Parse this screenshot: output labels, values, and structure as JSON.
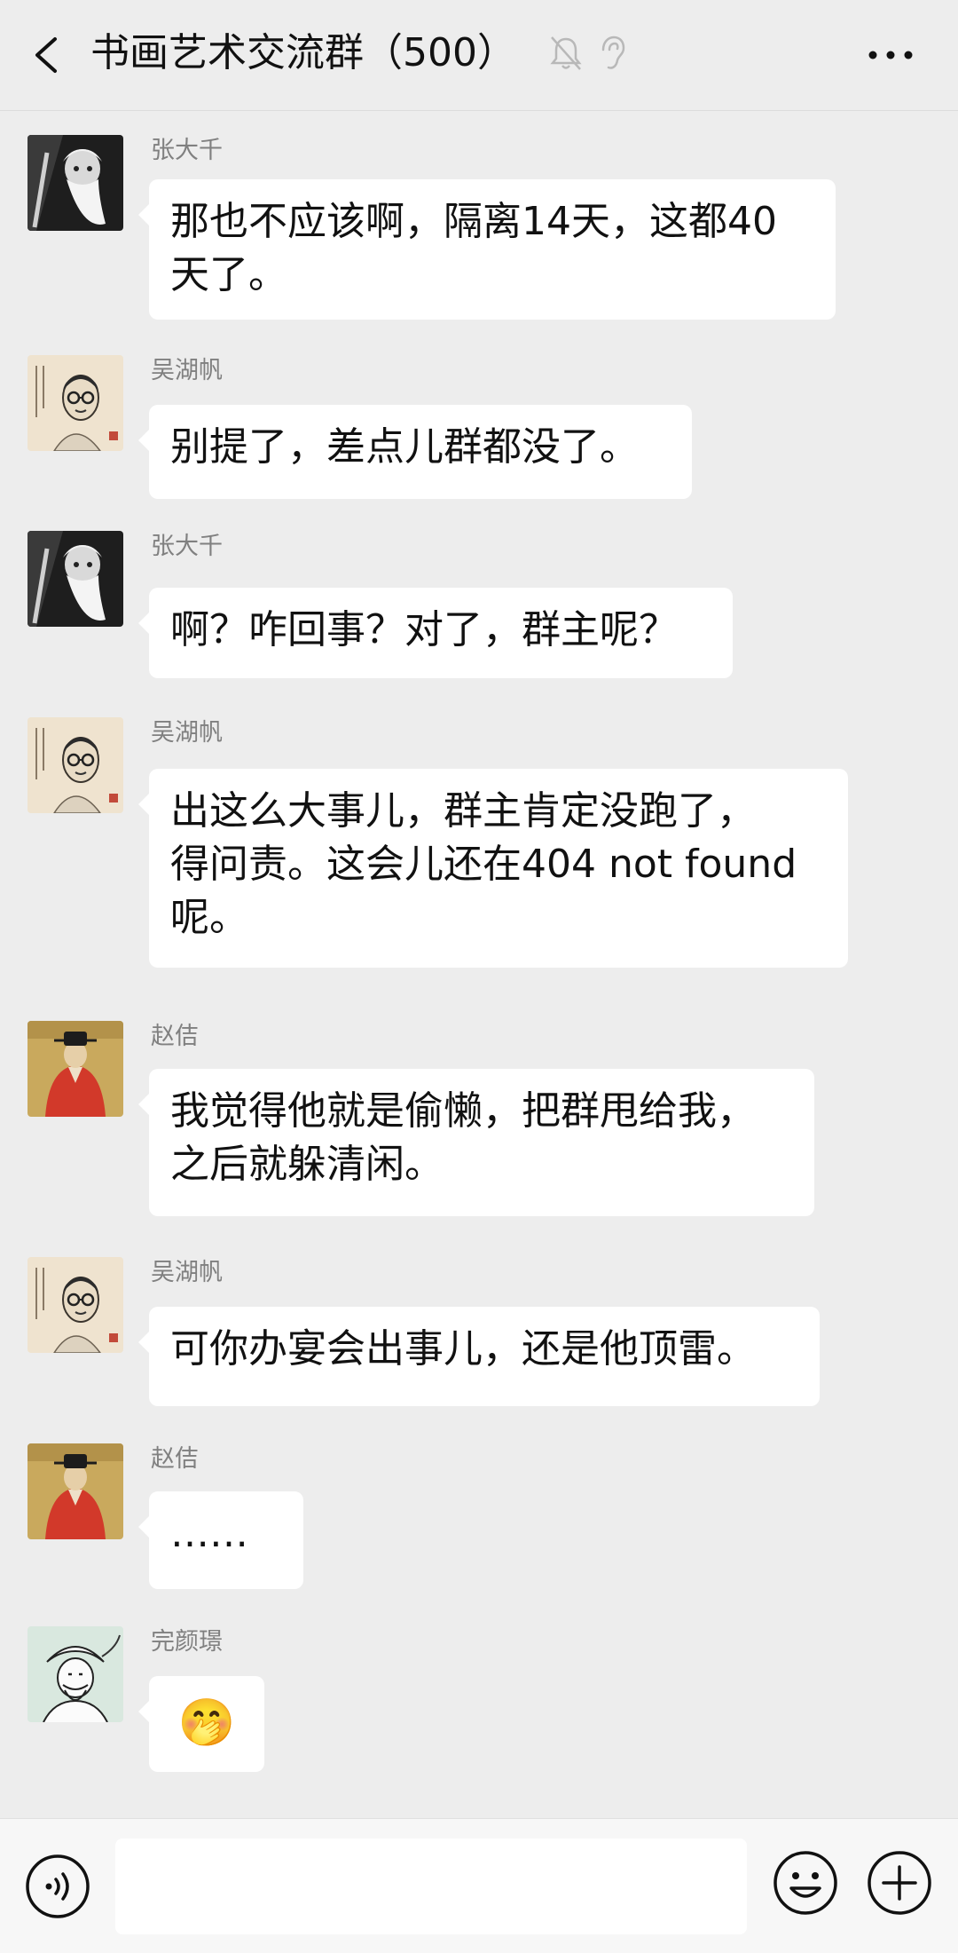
{
  "header": {
    "title": "书画艺术交流群（500）",
    "icons": [
      "back-arrow-icon",
      "mute-bell-icon",
      "earpiece-icon",
      "more-options-icon"
    ]
  },
  "messages": [
    {
      "sender": "张大千",
      "avatar": "bearded-elder-avatar",
      "lines": [
        "那也不应该啊，隔离14天，这都40",
        "天了。"
      ]
    },
    {
      "sender": "吴湖帆",
      "avatar": "bespectacled-man-avatar",
      "lines": [
        "别提了，差点儿群都没了。"
      ]
    },
    {
      "sender": "张大千",
      "avatar": "bearded-elder-avatar",
      "lines": [
        "啊？咋回事？对了，群主呢？"
      ]
    },
    {
      "sender": "吴湖帆",
      "avatar": "bespectacled-man-avatar",
      "lines": [
        "出这么大事儿，群主肯定没跑了，",
        "得问责。这会儿还在404 not found",
        "呢。"
      ]
    },
    {
      "sender": "赵佶",
      "avatar": "emperor-red-robe-avatar",
      "lines": [
        "我觉得他就是偷懒，把群甩给我，",
        "之后就躲清闲。"
      ]
    },
    {
      "sender": "吴湖帆",
      "avatar": "bespectacled-man-avatar",
      "lines": [
        "可你办宴会出事儿，还是他顶雷。"
      ]
    },
    {
      "sender": "赵佶",
      "avatar": "emperor-red-robe-avatar",
      "lines": [
        "……"
      ]
    },
    {
      "sender": "完颜璟",
      "avatar": "jin-emperor-sketch-avatar",
      "emoji": "🤭"
    }
  ],
  "footer": {
    "input_value": "",
    "icons": [
      "voice-input-icon",
      "emoji-icon",
      "plus-icon"
    ]
  }
}
